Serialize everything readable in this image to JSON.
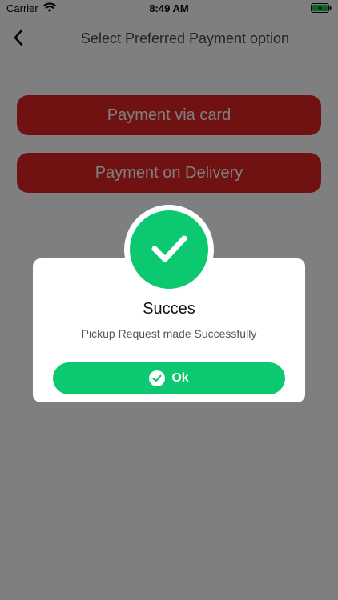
{
  "status_bar": {
    "carrier": "Carrier",
    "time": "8:49 AM",
    "icons": [
      "wifi-icon",
      "battery-charging-icon"
    ]
  },
  "nav": {
    "title": "Select Preferred Payment option",
    "back_icon": "chevron-left-icon"
  },
  "payment_options": {
    "card_label": "Payment via card",
    "delivery_label": "Payment on Delivery"
  },
  "modal": {
    "title": "Succes",
    "message": "Pickup Request made Successfully",
    "ok_label": "Ok",
    "badge_icon": "checkmark-icon"
  },
  "colors": {
    "payment_button": "#e02424",
    "success_green": "#0cc971",
    "overlay": "rgba(0,0,0,0.5)"
  }
}
